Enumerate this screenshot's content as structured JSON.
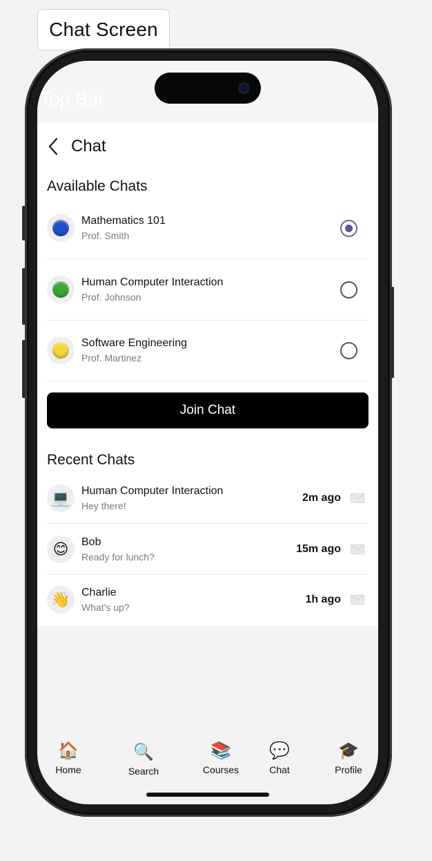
{
  "frame_label": "Chat Screen",
  "topbar": {
    "label": "Top Bar"
  },
  "header": {
    "title": "Chat"
  },
  "available": {
    "title": "Available Chats",
    "items": [
      {
        "name": "Mathematics 101",
        "instructor": "Prof. Smith",
        "dot_color": "#1f4fc4",
        "selected": true
      },
      {
        "name": "Human Computer Interaction",
        "instructor": "Prof. Johnson",
        "dot_color": "#3aa635",
        "selected": false
      },
      {
        "name": "Software Engineering",
        "instructor": "Prof. Martinez",
        "dot_color": "#f6d53a",
        "selected": false
      }
    ]
  },
  "join_button": "Join Chat",
  "recent": {
    "title": "Recent Chats",
    "items": [
      {
        "name": "Human Computer Interaction",
        "message": "Hey there!",
        "time": "2m ago",
        "icon": "laptop-icon",
        "emoji": "💻"
      },
      {
        "name": "Bob",
        "message": "Ready for lunch?",
        "time": "15m ago",
        "icon": "smile-icon",
        "emoji": "😊"
      },
      {
        "name": "Charlie",
        "message": "What's up?",
        "time": "1h ago",
        "icon": "wave-icon",
        "emoji": "👋"
      }
    ]
  },
  "tabs": [
    {
      "label": "Home",
      "icon": "house-icon",
      "emoji": "🏠"
    },
    {
      "label": "Search",
      "icon": "magnifier-icon",
      "emoji": "🔍"
    },
    {
      "label": "Courses",
      "icon": "books-icon",
      "emoji": "📚"
    },
    {
      "label": "Chat",
      "icon": "speech-bubble-icon",
      "emoji": "💬"
    },
    {
      "label": "Profile",
      "icon": "graduation-cap-icon",
      "emoji": "🎓"
    }
  ]
}
